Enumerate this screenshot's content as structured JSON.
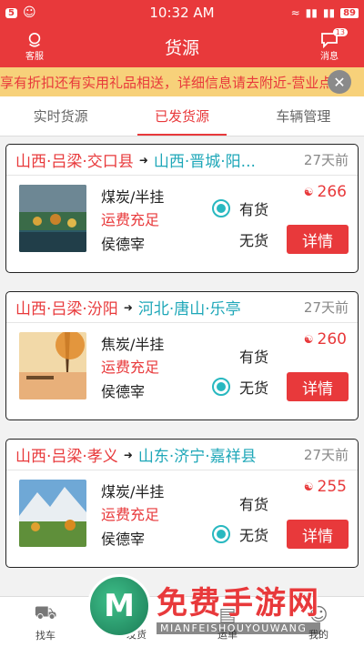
{
  "status_bar": {
    "badge": "5",
    "time": "10:32 AM",
    "battery": "89"
  },
  "header": {
    "left_label": "客服",
    "title": "货源",
    "right_label": "消息",
    "message_count": "13"
  },
  "notice": {
    "text": "享有折扣还有实用礼品相送，详细信息请去附近-营业点查"
  },
  "tabs": [
    {
      "label": "实时货源",
      "active": false
    },
    {
      "label": "已发货源",
      "active": true
    },
    {
      "label": "车辆管理",
      "active": false
    }
  ],
  "cards": [
    {
      "from": "山西·吕梁·交口县",
      "to": "山西·晋城·阳...",
      "time": "27天前",
      "cargo": "煤炭/半挂",
      "freight": "运费充足",
      "contact": "侯德宰",
      "price": "266",
      "in_stock_label": "有货",
      "out_stock_label": "无货",
      "selected": "in_stock",
      "button": "详情"
    },
    {
      "from": "山西·吕梁·汾阳",
      "to": "河北·唐山·乐亭",
      "time": "27天前",
      "cargo": "焦炭/半挂",
      "freight": "运费充足",
      "contact": "侯德宰",
      "price": "260",
      "in_stock_label": "有货",
      "out_stock_label": "无货",
      "selected": "out_of_stock",
      "button": "详情"
    },
    {
      "from": "山西·吕梁·孝义",
      "to": "山东·济宁·嘉祥县",
      "time": "27天前",
      "cargo": "煤炭/半挂",
      "freight": "运费充足",
      "contact": "侯德宰",
      "price": "255",
      "in_stock_label": "有货",
      "out_stock_label": "无货",
      "selected": "out_of_stock",
      "button": "详情"
    }
  ],
  "bottom_nav": [
    {
      "label": "找车",
      "icon": "truck-icon"
    },
    {
      "label": "发货",
      "icon": "send-icon"
    },
    {
      "label": "运单",
      "icon": "document-icon"
    },
    {
      "label": "我的",
      "icon": "user-icon"
    }
  ],
  "watermark": {
    "main": "免费手游网",
    "sub": "MIANFEISHOUYOUWANG"
  },
  "colors": {
    "brand_red": "#e8393b",
    "teal": "#1ea7b8",
    "notice_bg": "#f7d17a"
  }
}
